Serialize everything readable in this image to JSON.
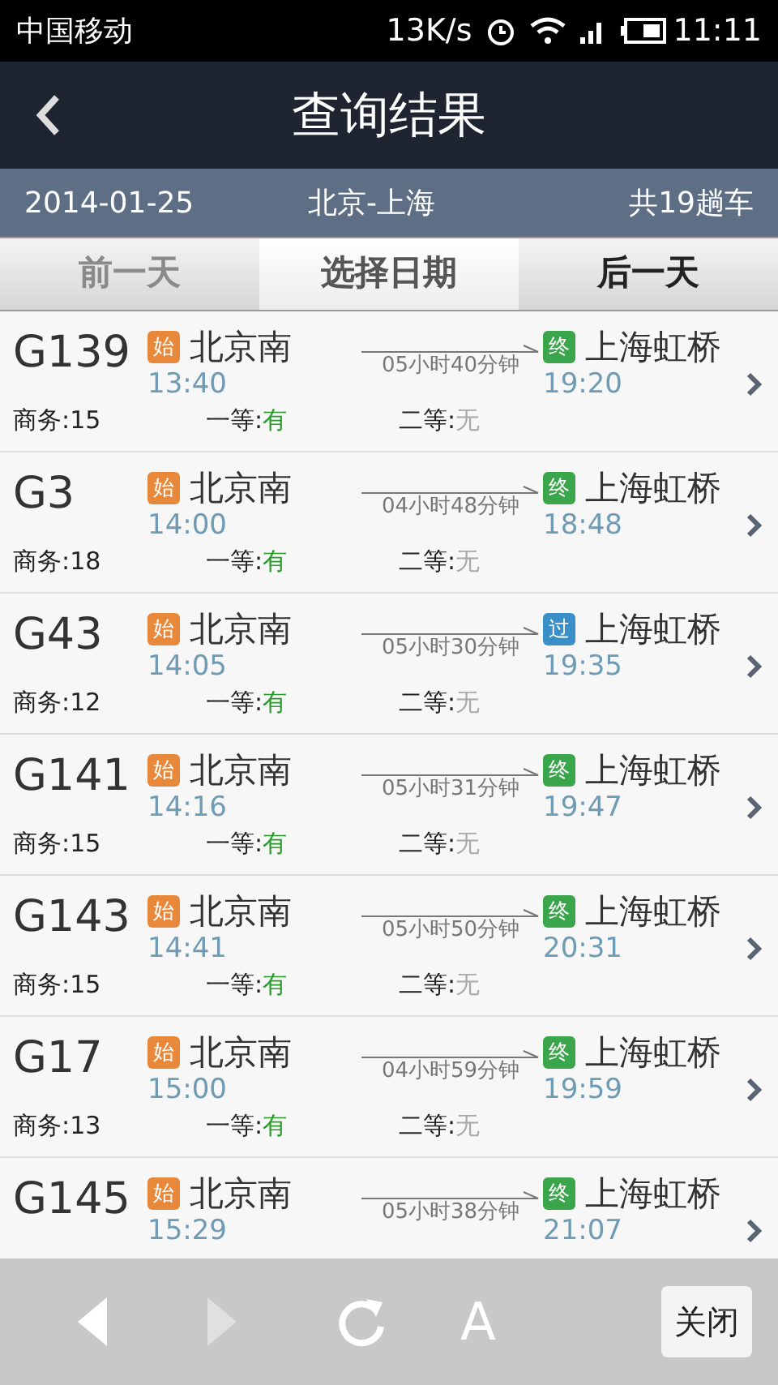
{
  "status_bar": {
    "carrier": "中国移动",
    "speed": "13K/s",
    "time": "11:11"
  },
  "header": {
    "title": "查询结果"
  },
  "info_bar": {
    "date": "2014-01-25",
    "route": "北京-上海",
    "count": "共19趟车"
  },
  "date_nav": [
    {
      "label": "前一天",
      "disabled": true
    },
    {
      "label": "选择日期",
      "disabled": false
    },
    {
      "label": "后一天",
      "disabled": false
    }
  ],
  "trains": [
    {
      "number": "G139",
      "from_badge": {
        "text": "始",
        "color": "#e8883a"
      },
      "from": "北京南",
      "depart": "13:40",
      "duration": "05小时40分钟",
      "to_badge": {
        "text": "终",
        "color": "#3aa54a"
      },
      "to": "上海虹桥",
      "arrive": "19:20",
      "seats": [
        {
          "label": "商务:",
          "value": "15",
          "available": true,
          "kind": "count"
        },
        {
          "label": "一等:",
          "value": "有",
          "available": true,
          "kind": "flag"
        },
        {
          "label": "二等:",
          "value": "无",
          "available": false,
          "kind": "flag"
        }
      ]
    },
    {
      "number": "G3",
      "from_badge": {
        "text": "始",
        "color": "#e8883a"
      },
      "from": "北京南",
      "depart": "14:00",
      "duration": "04小时48分钟",
      "to_badge": {
        "text": "终",
        "color": "#3aa54a"
      },
      "to": "上海虹桥",
      "arrive": "18:48",
      "seats": [
        {
          "label": "商务:",
          "value": "18",
          "available": true,
          "kind": "count"
        },
        {
          "label": "一等:",
          "value": "有",
          "available": true,
          "kind": "flag"
        },
        {
          "label": "二等:",
          "value": "无",
          "available": false,
          "kind": "flag"
        }
      ]
    },
    {
      "number": "G43",
      "from_badge": {
        "text": "始",
        "color": "#e8883a"
      },
      "from": "北京南",
      "depart": "14:05",
      "duration": "05小时30分钟",
      "to_badge": {
        "text": "过",
        "color": "#3a8fc8"
      },
      "to": "上海虹桥",
      "arrive": "19:35",
      "seats": [
        {
          "label": "商务:",
          "value": "12",
          "available": true,
          "kind": "count"
        },
        {
          "label": "一等:",
          "value": "有",
          "available": true,
          "kind": "flag"
        },
        {
          "label": "二等:",
          "value": "无",
          "available": false,
          "kind": "flag"
        }
      ]
    },
    {
      "number": "G141",
      "from_badge": {
        "text": "始",
        "color": "#e8883a"
      },
      "from": "北京南",
      "depart": "14:16",
      "duration": "05小时31分钟",
      "to_badge": {
        "text": "终",
        "color": "#3aa54a"
      },
      "to": "上海虹桥",
      "arrive": "19:47",
      "seats": [
        {
          "label": "商务:",
          "value": "15",
          "available": true,
          "kind": "count"
        },
        {
          "label": "一等:",
          "value": "有",
          "available": true,
          "kind": "flag"
        },
        {
          "label": "二等:",
          "value": "无",
          "available": false,
          "kind": "flag"
        }
      ]
    },
    {
      "number": "G143",
      "from_badge": {
        "text": "始",
        "color": "#e8883a"
      },
      "from": "北京南",
      "depart": "14:41",
      "duration": "05小时50分钟",
      "to_badge": {
        "text": "终",
        "color": "#3aa54a"
      },
      "to": "上海虹桥",
      "arrive": "20:31",
      "seats": [
        {
          "label": "商务:",
          "value": "15",
          "available": true,
          "kind": "count"
        },
        {
          "label": "一等:",
          "value": "有",
          "available": true,
          "kind": "flag"
        },
        {
          "label": "二等:",
          "value": "无",
          "available": false,
          "kind": "flag"
        }
      ]
    },
    {
      "number": "G17",
      "from_badge": {
        "text": "始",
        "color": "#e8883a"
      },
      "from": "北京南",
      "depart": "15:00",
      "duration": "04小时59分钟",
      "to_badge": {
        "text": "终",
        "color": "#3aa54a"
      },
      "to": "上海虹桥",
      "arrive": "19:59",
      "seats": [
        {
          "label": "商务:",
          "value": "13",
          "available": true,
          "kind": "count"
        },
        {
          "label": "一等:",
          "value": "有",
          "available": true,
          "kind": "flag"
        },
        {
          "label": "二等:",
          "value": "无",
          "available": false,
          "kind": "flag"
        }
      ]
    },
    {
      "number": "G145",
      "from_badge": {
        "text": "始",
        "color": "#e8883a"
      },
      "from": "北京南",
      "depart": "15:29",
      "duration": "05小时38分钟",
      "to_badge": {
        "text": "终",
        "color": "#3aa54a"
      },
      "to": "上海虹桥",
      "arrive": "21:07"
    }
  ],
  "toolbar": {
    "back_disabled": false,
    "forward_disabled": true,
    "font_button": "A",
    "close_button": "关闭"
  }
}
